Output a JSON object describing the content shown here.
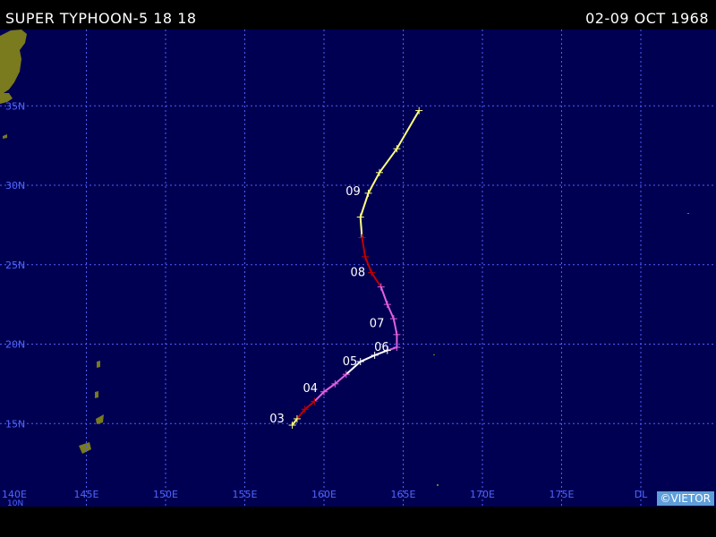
{
  "header": {
    "storm_title": "SUPER TYPHOON-5 18 18",
    "date_range": "02-09 OCT 1968"
  },
  "credit": "©VIETOR",
  "colors": {
    "ocean": "#000052",
    "land": "#7a7a1e",
    "grid": "#4b62ff",
    "label": "#5066ff",
    "track_typhoon": "#ffff80",
    "track_strong": "#c00000",
    "track_super": "#e060e0",
    "track_storm": "#ffffff"
  },
  "map": {
    "lon_range": [
      140,
      185
    ],
    "lat_range": [
      10,
      38
    ],
    "lon_labels": [
      "140E",
      "145E",
      "150E",
      "155E",
      "160E",
      "165E",
      "170E",
      "175E",
      "DL"
    ],
    "lat_labels": [
      "15N",
      "20N",
      "25N",
      "30N",
      "35N"
    ],
    "extra_lat_label": "10N"
  },
  "track": {
    "day_labels": [
      {
        "text": "03",
        "lon": 157.7,
        "lat": 15.3
      },
      {
        "text": "04",
        "lon": 159.8,
        "lat": 17.2
      },
      {
        "text": "05",
        "lon": 162.3,
        "lat": 18.9
      },
      {
        "text": "06",
        "lon": 164.3,
        "lat": 19.8
      },
      {
        "text": "07",
        "lon": 164.0,
        "lat": 21.3
      },
      {
        "text": "08",
        "lon": 162.8,
        "lat": 24.5
      },
      {
        "text": "09",
        "lon": 162.5,
        "lat": 29.6
      }
    ],
    "points": [
      {
        "lon": 158.0,
        "lat": 14.9,
        "cat": "typhoon"
      },
      {
        "lon": 158.3,
        "lat": 15.3,
        "cat": "typhoon"
      },
      {
        "lon": 158.8,
        "lat": 15.9,
        "cat": "strong"
      },
      {
        "lon": 159.4,
        "lat": 16.4,
        "cat": "strong"
      },
      {
        "lon": 160.0,
        "lat": 17.0,
        "cat": "super"
      },
      {
        "lon": 160.7,
        "lat": 17.5,
        "cat": "super"
      },
      {
        "lon": 161.4,
        "lat": 18.1,
        "cat": "super"
      },
      {
        "lon": 162.3,
        "lat": 18.9,
        "cat": "storm"
      },
      {
        "lon": 163.2,
        "lat": 19.3,
        "cat": "storm"
      },
      {
        "lon": 164.0,
        "lat": 19.6,
        "cat": "storm"
      },
      {
        "lon": 164.6,
        "lat": 19.8,
        "cat": "super"
      },
      {
        "lon": 164.6,
        "lat": 20.6,
        "cat": "super"
      },
      {
        "lon": 164.4,
        "lat": 21.6,
        "cat": "super"
      },
      {
        "lon": 164.0,
        "lat": 22.5,
        "cat": "super"
      },
      {
        "lon": 163.6,
        "lat": 23.6,
        "cat": "super"
      },
      {
        "lon": 163.0,
        "lat": 24.5,
        "cat": "strong"
      },
      {
        "lon": 162.6,
        "lat": 25.5,
        "cat": "strong"
      },
      {
        "lon": 162.4,
        "lat": 26.7,
        "cat": "strong"
      },
      {
        "lon": 162.3,
        "lat": 28.0,
        "cat": "typhoon"
      },
      {
        "lon": 162.8,
        "lat": 29.5,
        "cat": "typhoon"
      },
      {
        "lon": 163.5,
        "lat": 30.8,
        "cat": "typhoon"
      },
      {
        "lon": 164.6,
        "lat": 32.3,
        "cat": "typhoon"
      },
      {
        "lon": 166.0,
        "lat": 34.7,
        "cat": "typhoon"
      }
    ]
  }
}
